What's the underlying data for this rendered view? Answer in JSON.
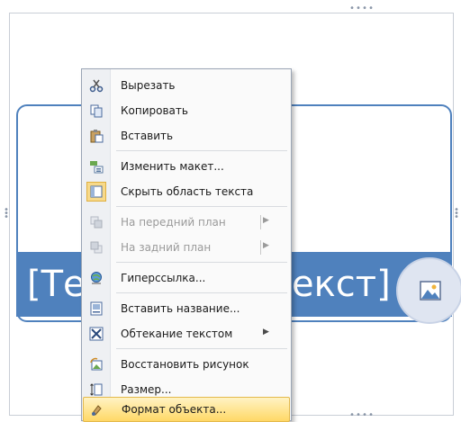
{
  "slide": {
    "text_left": "[Те",
    "text_right": "екст]"
  },
  "menu": {
    "items": [
      {
        "label": "Вырезать",
        "icon": "scissors-icon",
        "disabled": false
      },
      {
        "label": "Копировать",
        "icon": "copy-icon",
        "disabled": false
      },
      {
        "label": "Вставить",
        "icon": "paste-icon",
        "disabled": false
      },
      {
        "label": "Изменить макет...",
        "icon": "change-layout-icon",
        "disabled": false
      },
      {
        "label": "Скрыть область текста",
        "icon": "text-pane-icon",
        "disabled": false
      },
      {
        "label": "На передний план",
        "icon": "bring-forward-icon",
        "disabled": true,
        "submenu": true
      },
      {
        "label": "На задний план",
        "icon": "send-backward-icon",
        "disabled": true,
        "submenu": true
      },
      {
        "label": "Гиперссылка...",
        "icon": "hyperlink-icon",
        "disabled": false
      },
      {
        "label": "Вставить название...",
        "icon": "caption-icon",
        "disabled": false
      },
      {
        "label": "Обтекание текстом",
        "icon": "text-wrap-icon",
        "disabled": false,
        "submenu": true
      },
      {
        "label": "Восстановить рисунок",
        "icon": "reset-picture-icon",
        "disabled": false
      },
      {
        "label": "Размер...",
        "icon": "size-icon",
        "disabled": false
      },
      {
        "label": "Формат объекта...",
        "icon": "format-object-icon",
        "disabled": false,
        "highlighted": true
      }
    ]
  },
  "colors": {
    "accent_blue": "#4f81bd",
    "menu_highlight": "#ffd866"
  }
}
